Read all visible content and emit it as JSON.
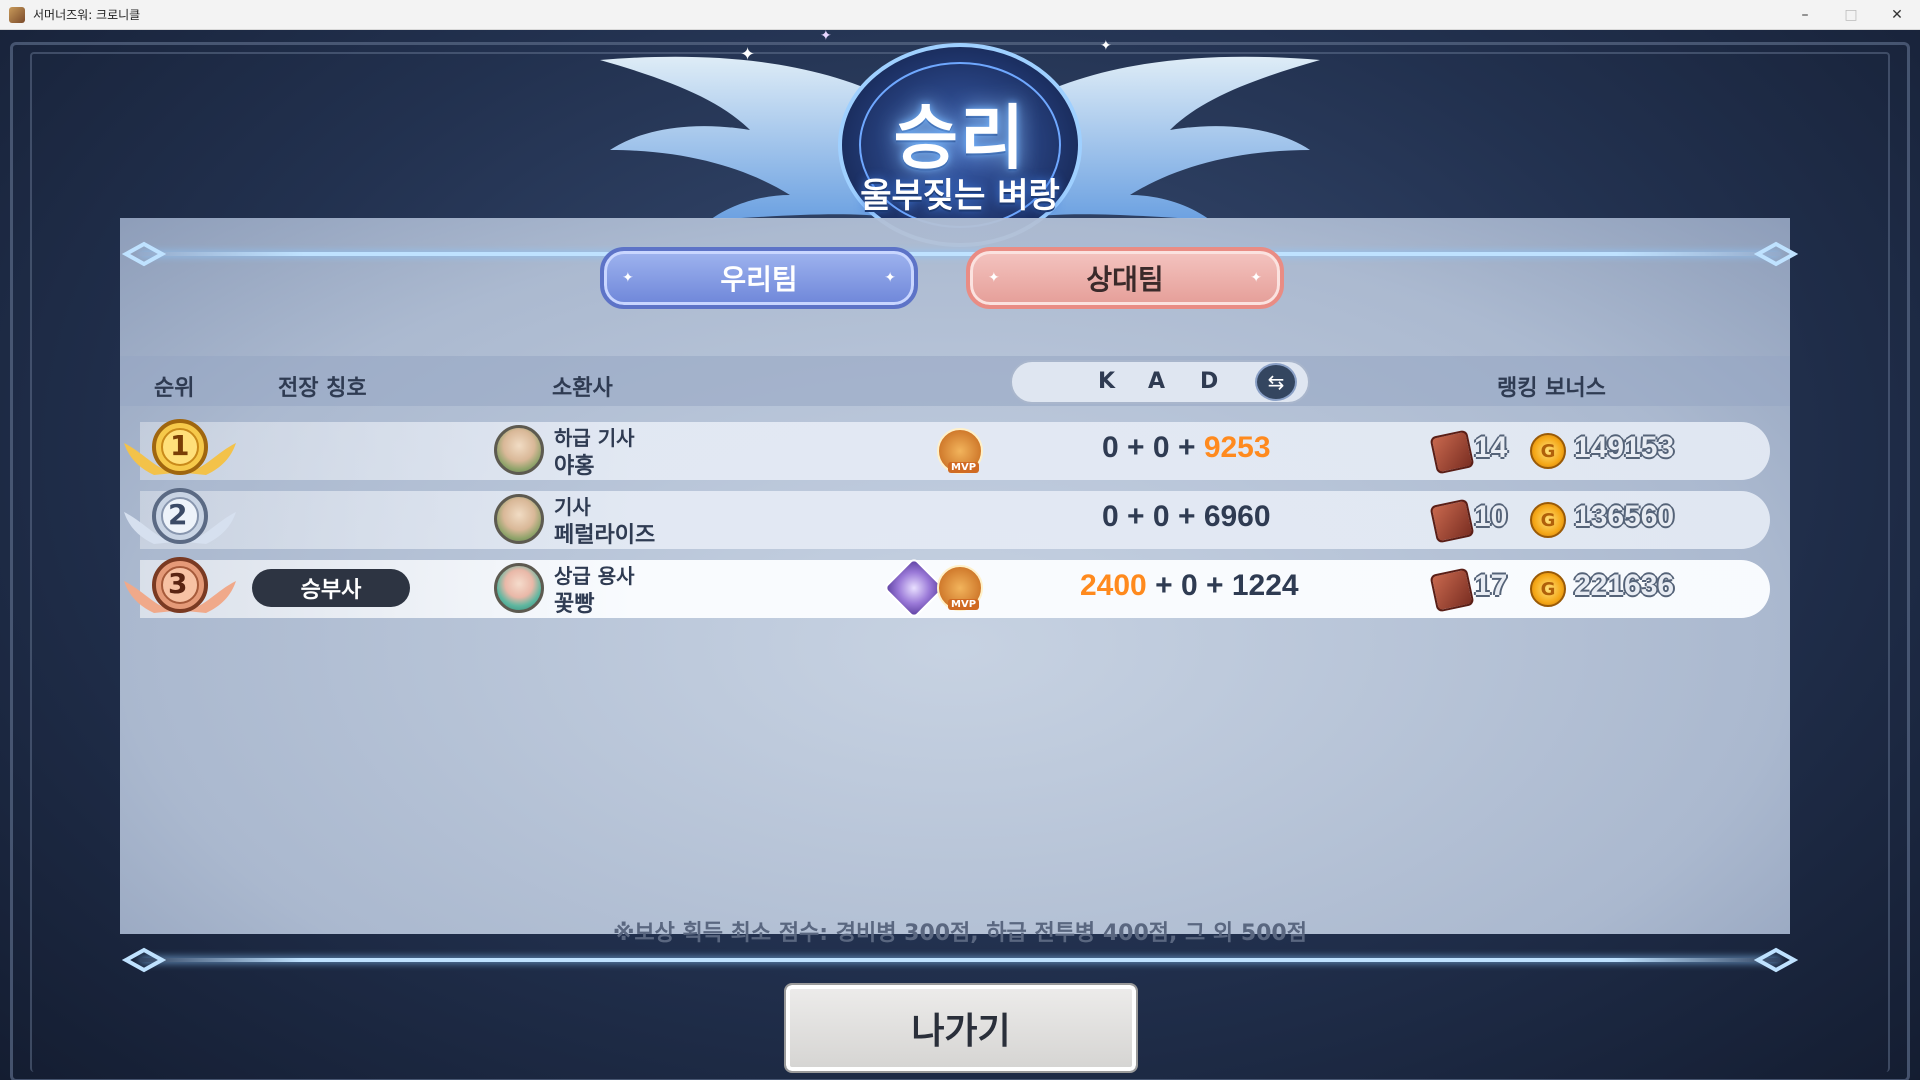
{
  "window": {
    "title": "서머너즈워: 크로니클",
    "minimize": "–",
    "maximize": "□",
    "close": "✕"
  },
  "result": {
    "title": "승리",
    "subtitle": "울부짖는 벼랑"
  },
  "tabs": {
    "ours": "우리팀",
    "enemy": "상대팀"
  },
  "headers": {
    "rank": "순위",
    "title": "전장 칭호",
    "summoner": "소환사",
    "k": "K",
    "a": "A",
    "d": "D",
    "bonus": "랭킹 보너스"
  },
  "rows": [
    {
      "rank": "1",
      "title": "",
      "grade": "하급 기사",
      "name": "야홍",
      "kad": [
        "0",
        "+",
        "0",
        "+",
        "9253"
      ],
      "crates": "14",
      "coins": "149153",
      "mvp_tag": "MVP"
    },
    {
      "rank": "2",
      "title": "",
      "grade": "기사",
      "name": "페럴라이즈",
      "kad": [
        "0",
        "+",
        "0",
        "+",
        "6960"
      ],
      "crates": "10",
      "coins": "136560"
    },
    {
      "rank": "3",
      "title": "승부사",
      "grade": "상급 용사",
      "name": "꽃빵",
      "kad": [
        "2400",
        "+",
        "0",
        "+",
        "1224"
      ],
      "crates": "17",
      "coins": "221636",
      "mvp_tag": "MVP"
    }
  ],
  "footnote": "※보상 획득 최소 점수: 경비병 300점, 하급 전투병 400점, 그 외 500점",
  "exit_label": "나가기",
  "coin_glyph": "G",
  "colors": {
    "highlight": "#ff8a1e",
    "tab_ours": "#7a90dd",
    "tab_enemy": "#eba8a2"
  }
}
